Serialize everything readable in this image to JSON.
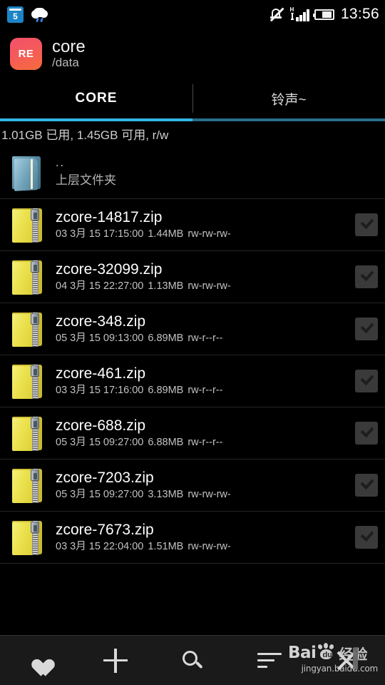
{
  "status_bar": {
    "calendar_day": "5",
    "icons": [
      "calendar-icon",
      "cloud-rain-icon",
      "mute-bell-icon",
      "signal-hspa-icon",
      "battery-icon"
    ],
    "network_type": "H",
    "time": "13:56"
  },
  "app_header": {
    "app_badge": "RE",
    "title": "core",
    "subtitle": "/data"
  },
  "tabs": [
    {
      "label": "CORE",
      "active": true
    },
    {
      "label": "铃声~",
      "active": false
    }
  ],
  "storage_info": "1.01GB 已用, 1.45GB 可用, r/w",
  "accent_color": "#33b5e5",
  "file_list": [
    {
      "type": "parent",
      "name": "..",
      "subtitle": "上层文件夹",
      "icon": "folder-blue-icon",
      "checked": false
    },
    {
      "type": "zip",
      "name": "zcore-14817.zip",
      "date": "03 3月 15 17:15:00",
      "size": "1.44MB",
      "permissions": "rw-rw-rw-",
      "icon": "folder-zip-icon",
      "checked": true
    },
    {
      "type": "zip",
      "name": "zcore-32099.zip",
      "date": "04 3月 15 22:27:00",
      "size": "1.13MB",
      "permissions": "rw-rw-rw-",
      "icon": "folder-zip-icon",
      "checked": true
    },
    {
      "type": "zip",
      "name": "zcore-348.zip",
      "date": "05 3月 15 09:13:00",
      "size": "6.89MB",
      "permissions": "rw-r--r--",
      "icon": "folder-zip-icon",
      "checked": true
    },
    {
      "type": "zip",
      "name": "zcore-461.zip",
      "date": "03 3月 15 17:16:00",
      "size": "6.89MB",
      "permissions": "rw-r--r--",
      "icon": "folder-zip-icon",
      "checked": true
    },
    {
      "type": "zip",
      "name": "zcore-688.zip",
      "date": "05 3月 15 09:27:00",
      "size": "6.88MB",
      "permissions": "rw-r--r--",
      "icon": "folder-zip-icon",
      "checked": true
    },
    {
      "type": "zip",
      "name": "zcore-7203.zip",
      "date": "05 3月 15 09:27:00",
      "size": "3.13MB",
      "permissions": "rw-rw-rw-",
      "icon": "folder-zip-icon",
      "checked": true
    },
    {
      "type": "zip",
      "name": "zcore-7673.zip",
      "date": "03 3月 15 22:04:00",
      "size": "1.51MB",
      "permissions": "rw-rw-rw-",
      "icon": "folder-zip-icon",
      "checked": true
    }
  ],
  "bottom_bar": [
    {
      "icon": "heart-icon",
      "label": ""
    },
    {
      "icon": "plus-icon",
      "label": ""
    },
    {
      "icon": "search-icon",
      "label": ""
    },
    {
      "icon": "sort-icon",
      "label": ""
    },
    {
      "icon": "close-x-icon",
      "label": ""
    }
  ],
  "watermark": {
    "brand": "Bai",
    "suffix": "经验",
    "paw_text": "du",
    "url": "jingyan.baidu.com"
  }
}
